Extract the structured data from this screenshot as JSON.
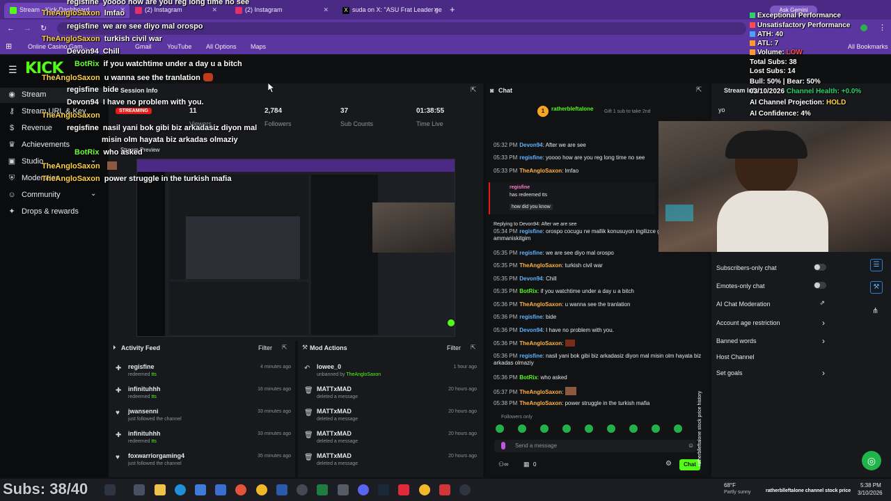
{
  "browser": {
    "tabs": [
      {
        "label": "Stream - Kick Dashboard"
      },
      {
        "label": "(2) Instagram"
      },
      {
        "label": "(2) Instagram"
      },
      {
        "label": "suda on X: \"ASU Frat Leader ge"
      }
    ],
    "ask_gemini": "Ask Gemini",
    "bookmarks": [
      "Online Casino Gam...",
      "Gmail",
      "YouTube",
      "All Options",
      "Maps"
    ],
    "all_bookmarks": "All Bookmarks"
  },
  "sidebar": {
    "logo": "KICK",
    "items": [
      {
        "label": "Stream",
        "icon": "stream-icon"
      },
      {
        "label": "Stream URL & Key",
        "icon": "key-icon"
      },
      {
        "label": "Revenue",
        "icon": "dollar-icon"
      },
      {
        "label": "Achievements",
        "icon": "trophy-icon"
      },
      {
        "label": "Studio",
        "icon": "studio-icon"
      },
      {
        "label": "Moderation",
        "icon": "shield-icon"
      },
      {
        "label": "Community",
        "icon": "users-icon"
      },
      {
        "label": "Drops & rewards",
        "icon": "gift-icon"
      }
    ]
  },
  "session": {
    "title": "Session Info",
    "status": "STREAMING",
    "stats": [
      {
        "value": "11",
        "label": "Viewers"
      },
      {
        "value": "2,784",
        "label": "Followers"
      },
      {
        "value": "37",
        "label": "Sub Counts"
      },
      {
        "value": "01:38:55",
        "label": "Time Live"
      }
    ],
    "preview_label": "Stream Preview"
  },
  "activity_feed": {
    "title": "Activity Feed",
    "filter": "Filter",
    "items": [
      {
        "name": "regisfine",
        "action": "redeemed",
        "detail": "tts",
        "time": "4 minutes ago",
        "icon": "redeem-icon"
      },
      {
        "name": "infinituhhh",
        "action": "redeemed",
        "detail": "tts",
        "time": "16 minutes ago",
        "icon": "redeem-icon"
      },
      {
        "name": "jwansenni",
        "action": "just followed the channel",
        "detail": "",
        "time": "33 minutes ago",
        "icon": "heart-icon"
      },
      {
        "name": "infinituhhh",
        "action": "redeemed",
        "detail": "tts",
        "time": "33 minutes ago",
        "icon": "redeem-icon"
      },
      {
        "name": "foxwarriorgaming4",
        "action": "just followed the channel",
        "detail": "",
        "time": "35 minutes ago",
        "icon": "heart-icon"
      }
    ]
  },
  "mod_actions": {
    "title": "Mod Actions",
    "filter": "Filter",
    "items": [
      {
        "name": "lowee_0",
        "action": "unbanned by",
        "by": "TheAngloSaxon",
        "time": "1 hour ago",
        "icon": "undo-icon"
      },
      {
        "name": "MATTxMAD",
        "action": "deleted a message",
        "by": "",
        "time": "20 hours ago",
        "icon": "trash-icon"
      },
      {
        "name": "MATTxMAD",
        "action": "deleted a message",
        "by": "",
        "time": "20 hours ago",
        "icon": "trash-icon"
      },
      {
        "name": "MATTxMAD",
        "action": "deleted a message",
        "by": "",
        "time": "20 hours ago",
        "icon": "trash-icon"
      },
      {
        "name": "MATTxMAD",
        "action": "deleted a message",
        "by": "",
        "time": "20 hours ago",
        "icon": "trash-icon"
      }
    ]
  },
  "chat": {
    "title": "Chat",
    "pinned_user": "ratherbleftalone",
    "pinned_text": "Gift 1 sub to take 2nd",
    "messages": [
      {
        "time": "05:32 PM",
        "user": "Devon94",
        "text": "After we are see",
        "color": "blue"
      },
      {
        "time": "05:33 PM",
        "user": "regisfine",
        "text": "yoooo how are you reg long time no see",
        "color": "blue"
      },
      {
        "time": "05:33 PM",
        "user": "TheAngloSaxon",
        "text": "lmfao",
        "color": "orange"
      },
      {
        "time": "05:34 PM",
        "user": "regisfine",
        "text": "orospo cocugu ne mallik konusuyon ingilizce gibi ammaniskitgim",
        "color": "blue"
      },
      {
        "time": "05:35 PM",
        "user": "regisfine",
        "text": "we are see diyo mal orospo",
        "color": "blue"
      },
      {
        "time": "05:35 PM",
        "user": "TheAngloSaxon",
        "text": "turkish civil war",
        "color": "orange"
      },
      {
        "time": "05:35 PM",
        "user": "Devon94",
        "text": "Chill",
        "color": "blue"
      },
      {
        "time": "05:35 PM",
        "user": "BotRix",
        "text": "if you watchtime under a day u a bitch",
        "color": "green"
      },
      {
        "time": "05:36 PM",
        "user": "TheAngloSaxon",
        "text": "u wanna see the tranlation",
        "color": "orange"
      },
      {
        "time": "05:36 PM",
        "user": "regisfine",
        "text": "bide",
        "color": "blue"
      },
      {
        "time": "05:36 PM",
        "user": "Devon94",
        "text": "I have no problem with you.",
        "color": "blue"
      },
      {
        "time": "05:36 PM",
        "user": "TheAngloSaxon",
        "text": "",
        "color": "orange"
      },
      {
        "time": "05:36 PM",
        "user": "regisfine",
        "text": "nasil yani bok gibi biz arkadasiz diyon mal misin olm hayata biz arkadas olmaziy",
        "color": "blue"
      },
      {
        "time": "05:36 PM",
        "user": "BotRix",
        "text": "who asked",
        "color": "green"
      },
      {
        "time": "05:37 PM",
        "user": "TheAngloSaxon",
        "text": "",
        "color": "orange"
      },
      {
        "time": "05:38 PM",
        "user": "TheAngloSaxon",
        "text": "power struggle in the turkish mafia",
        "color": "orange"
      }
    ],
    "redeem_user": "regisfine",
    "redeem_text": "has redeemed tts",
    "redeem_quote": "how did you know",
    "reply_note": "Replying to Devon94: After we are see",
    "followers_only": "Followers only",
    "send_placeholder": "Send a message",
    "count": "0",
    "chat_button": "Chat"
  },
  "settings": {
    "title": "Stream Info",
    "items": [
      {
        "label": "Subscribers-only chat",
        "kind": "toggle"
      },
      {
        "label": "Emotes-only chat",
        "kind": "toggle"
      },
      {
        "label": "AI Chat Moderation",
        "kind": "link"
      },
      {
        "label": "Account age restriction",
        "kind": "chevron"
      },
      {
        "label": "Banned words",
        "kind": "chevron"
      },
      {
        "label": "Host Channel",
        "kind": "none"
      },
      {
        "label": "Set goals",
        "kind": "chevron"
      }
    ]
  },
  "overlay_chat": [
    {
      "user": "regisfine",
      "text": "yoooo how are you reg long time no see",
      "color": "white"
    },
    {
      "user": "TheAngloSaxon",
      "text": "lmfao",
      "color": "gold"
    },
    {
      "user": "regisfine",
      "text": "we are see diyo mal orospo",
      "color": "white"
    },
    {
      "user": "TheAngloSaxon",
      "text": "turkish civil war",
      "color": "gold"
    },
    {
      "user": "Devon94",
      "text": "Chill",
      "color": "white"
    },
    {
      "user": "BotRix",
      "text": "if you watchtime under a day u a bitch",
      "color": "green"
    },
    {
      "user": "TheAngloSaxon",
      "text": "u wanna see the tranlation",
      "color": "gold"
    },
    {
      "user": "regisfine",
      "text": "bide",
      "color": "white"
    },
    {
      "user": "Devon94",
      "text": "I have no problem with you.",
      "color": "white"
    },
    {
      "user": "TheAngloSaxon",
      "text": "",
      "color": "gold"
    },
    {
      "user": "regisfine",
      "text": "nasil yani bok gibi biz arkadasiz diyon mal",
      "color": "white"
    },
    {
      "user": "",
      "text": "misin olm hayata biz arkadas olmaziy",
      "color": "white"
    },
    {
      "user": "BotRix",
      "text": "who asked",
      "color": "green"
    },
    {
      "user": "TheAngloSaxon",
      "text": "",
      "color": "gold"
    },
    {
      "user": "TheAngloSaxon",
      "text": "power struggle in the turkish mafia",
      "color": "gold"
    }
  ],
  "stats_overlay": {
    "lines": [
      {
        "text": "Exceptional Performance",
        "color": "#2bd46a"
      },
      {
        "text": "Unsatisfactory Performance",
        "color": "#ff4d4d"
      },
      {
        "text": "ATH: 40",
        "color": "#4aa3ff"
      },
      {
        "text": "ATL: 7",
        "color": "#ff9a2b"
      },
      {
        "text": "Volume: ",
        "color": "#ff9a2b",
        "accent": "LOW"
      },
      {
        "text": "Total Subs: 38",
        "color": ""
      },
      {
        "text": "Lost Subs: 14",
        "color": ""
      },
      {
        "text": "Bull: 50% | Bear: 50%",
        "color": ""
      },
      {
        "text": "03/10/2026",
        "color": "",
        "accent": "Channel Health: +0.0%"
      },
      {
        "text": "AI Channel Projection: ",
        "color": "",
        "accent": "HOLD"
      },
      {
        "text": "AI Confidence: 4%",
        "color": ""
      }
    ]
  },
  "webcam_side_text": "ratherblleftalone stock price history",
  "subs_goal": "Subs: 38/40",
  "taskbar": {
    "weather_temp": "68°F",
    "weather_desc": "Partly sunny",
    "ticker": "ratherblleftalone channel stock price",
    "time": "5:38 PM",
    "date": "3/10/2026"
  }
}
